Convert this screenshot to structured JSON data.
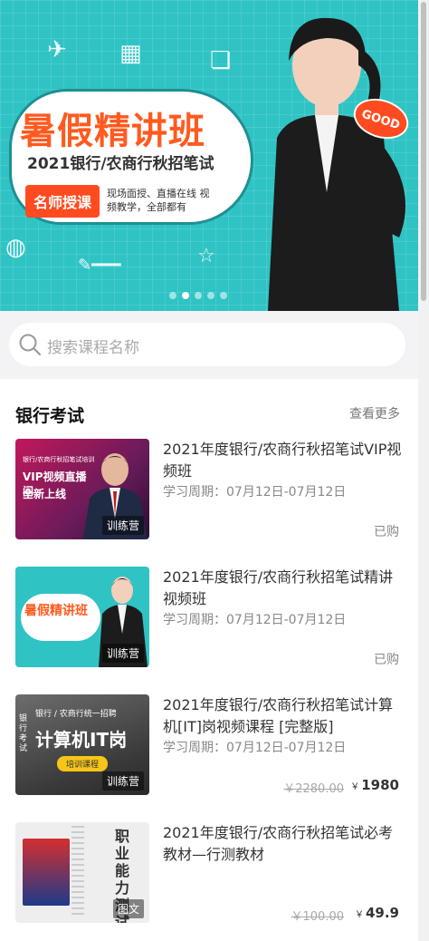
{
  "banner": {
    "title": "暑假精讲班",
    "subtitle": "2021银行/农商行秋招笔试",
    "tag": "名师授课",
    "tag_desc": "现场面授、直播在线 视频教学，全部都有",
    "good": "GOOD",
    "slide_count": 6,
    "active_slide": 1
  },
  "search": {
    "placeholder": "搜索课程名称"
  },
  "section": {
    "title": "银行考试",
    "more": "查看更多",
    "courses": [
      {
        "title": "2021年度银行/农商行秋招笔试VIP视频班",
        "period": "学习周期：07月12日-07月12日",
        "status": "已购",
        "thumb_label": "训练营",
        "thumb_main": "VIP视频直播间",
        "thumb_line2": "全新上线",
        "thumb_top": "银行/农商行秋招笔试培训"
      },
      {
        "title": "2021年度银行/农商行秋招笔试精讲视频班",
        "period": "学习周期：07月12日-07月12日",
        "status": "已购",
        "thumb_label": "训练营",
        "thumb_main": "暑假精讲班"
      },
      {
        "title": "2021年度银行/农商行秋招笔试计算机[IT]岗视频课程 [完整版]",
        "period": "学习周期：07月12日-07月12日",
        "old_price": "￥2280.00",
        "price": "1980",
        "currency": "￥",
        "thumb_label": "训练营",
        "thumb_main": "计算机IT岗",
        "thumb_top": "银行 / 农商行统一招聘",
        "thumb_pill": "培训课程",
        "thumb_side": "银行考试"
      },
      {
        "title": "2021年度银行/农商行秋招笔试必考教材—行测教材",
        "old_price": "￥100.00",
        "price": "49.9",
        "currency": "￥",
        "thumb_label": "图文",
        "thumb_main": "职业能力测试"
      }
    ]
  },
  "colors": {
    "banner_bg": "#2fc3c4",
    "accent": "#ff4b1f"
  }
}
